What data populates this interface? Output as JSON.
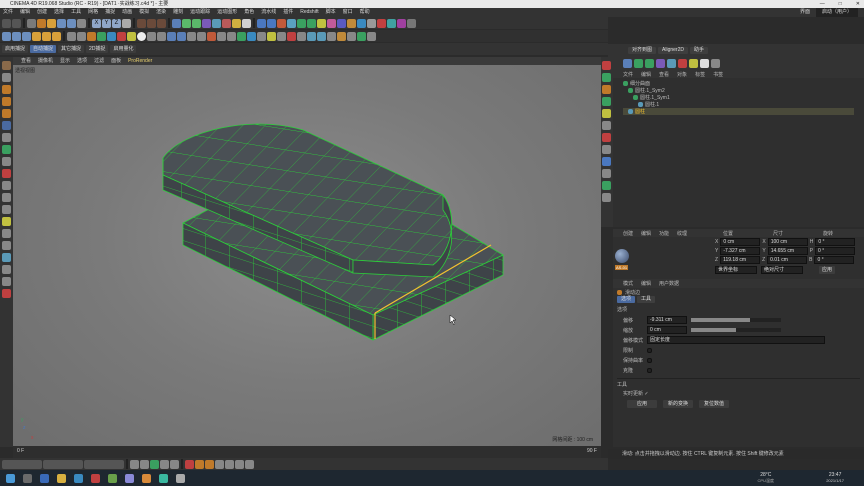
{
  "window": {
    "title": "CINEMA 4D R19.068 Studio (RC - R19) - [DAT1 ·实战练习.c4d *] - 主要",
    "controls": [
      "—",
      "□",
      "✕"
    ]
  },
  "menu": {
    "items": [
      "文件",
      "编辑",
      "创建",
      "选择",
      "工具",
      "网格",
      "捕捉",
      "动画",
      "模拟",
      "渲染",
      "雕刻",
      "运动跟踪",
      "运动图形",
      "角色",
      "流水线",
      "插件",
      "Redshift",
      "脚本",
      "窗口",
      "帮助"
    ],
    "right": [
      "界面",
      "启动（用户）"
    ]
  },
  "toolbar": {
    "axis_labels": [
      "X",
      "Y",
      "Z"
    ],
    "row3_labels": [
      "启用捕捉",
      "自动捕捉",
      "其它捕捉",
      "2D捕捉",
      "启用量化"
    ]
  },
  "viewport": {
    "menu": [
      "查看",
      "摄像机",
      "显示",
      "选项",
      "过滤",
      "面板",
      "ProRender"
    ],
    "camera_label": "透视视图",
    "grid_distance": "网格间距 : 100 cm",
    "axis": {
      "x": "x",
      "y": "y",
      "z": "z"
    }
  },
  "right_top_tabs": [
    "对齐到图",
    "Aligner2D",
    "助手"
  ],
  "object_manager": {
    "menu": [
      "文件",
      "编辑",
      "查看",
      "对象",
      "标签",
      "书签"
    ],
    "objects": [
      {
        "name": "细分曲面",
        "indent": 0
      },
      {
        "name": "圆柱.1_Sym2",
        "indent": 1
      },
      {
        "name": "圆柱.1_Sym1",
        "indent": 2
      },
      {
        "name": "圆柱.1",
        "indent": 3
      },
      {
        "name": "圆柱",
        "indent": 1
      }
    ]
  },
  "coord_manager": {
    "menu": [
      "创建",
      "编辑",
      "功能",
      "纹理"
    ],
    "headers": [
      "位置",
      "尺寸",
      "旋转"
    ],
    "rows": [
      {
        "axis": "X",
        "pos": "0 cm",
        "size_axis": "X",
        "size": "100 cm",
        "rot_axis": "H",
        "rot": "0 °"
      },
      {
        "axis": "Y",
        "pos": "-7.327 cm",
        "size_axis": "Y",
        "size": "14.655 cm",
        "rot_axis": "P",
        "rot": "0 °"
      },
      {
        "axis": "Z",
        "pos": "119.18 cm",
        "size_axis": "Z",
        "size": "0.01 cm",
        "rot_axis": "B",
        "rot": "0 °"
      }
    ],
    "dropdowns": [
      "世界坐标",
      "绝对尺寸"
    ],
    "apply": "应用"
  },
  "attr_manager": {
    "menu": [
      "模式",
      "编辑",
      "用户数据"
    ],
    "tool_name": "滑动边",
    "tabs": [
      "选项",
      "工具"
    ],
    "section": "选项",
    "fields": [
      {
        "label": "偏移",
        "value": "-9.311 cm",
        "fill": 0.65
      },
      {
        "label": "缩放",
        "value": "0 cm",
        "fill": 0.5
      },
      {
        "label": "偏移模式",
        "value": "固定长度"
      },
      {
        "label": "限制",
        "value": ""
      },
      {
        "label": "保持曲率",
        "value": ""
      },
      {
        "label": "克隆",
        "value": ""
      }
    ],
    "tool_section": "工具",
    "realtime_label": "实时更新 ✓",
    "buttons": [
      "应用",
      "新的变换",
      "复位数值"
    ]
  },
  "status": {
    "text": "滑动: 点击并拖拽以滑动边. 按住 CTRL 键复制元素. 按住 Shift 键修改元素",
    "timeline_start": "0 F",
    "timeline_end": "90 F"
  },
  "taskbar": {
    "time": "23:47",
    "date": "2021/1/17",
    "weather": "28°C",
    "weather_sub": "CPU温度"
  },
  "colors": {
    "mesh_face": "#4a5055",
    "mesh_edge": "#2ccf3a",
    "selected_edge": "#f2c230",
    "viewport_bg": "#7f7f7f"
  },
  "mat_label": "AS-01"
}
